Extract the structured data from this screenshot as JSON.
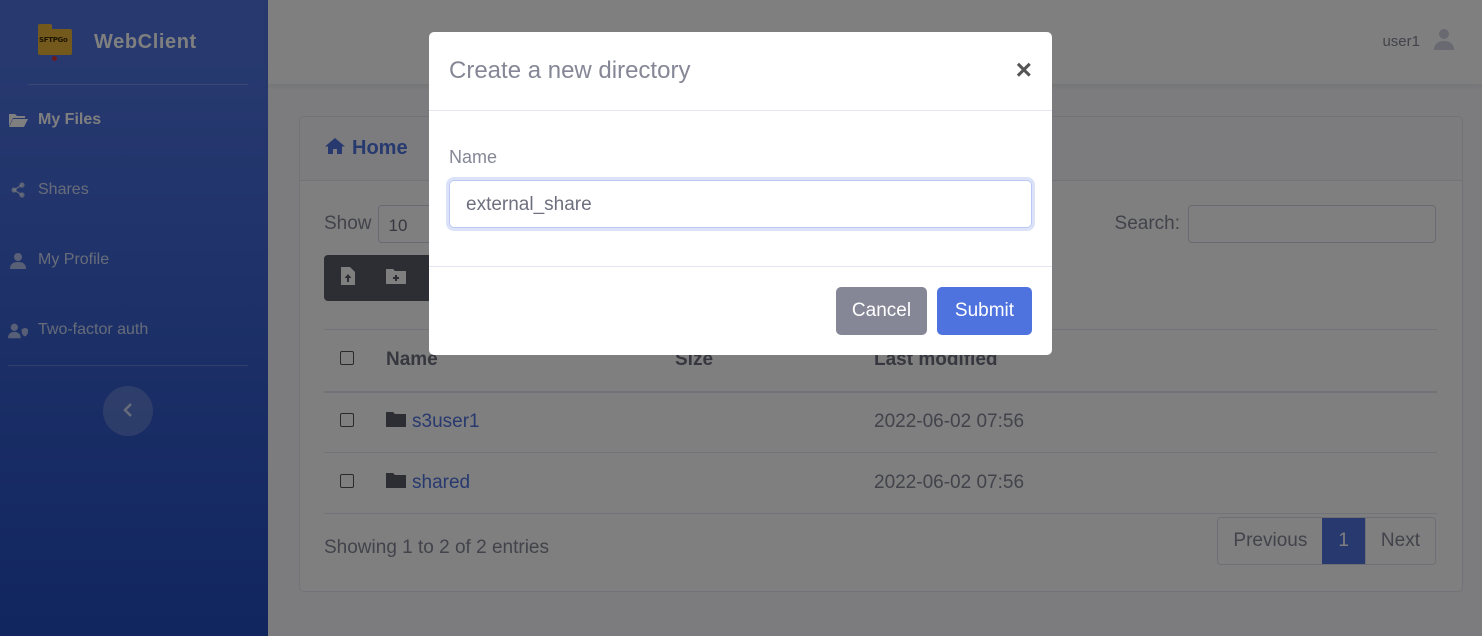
{
  "sidebar": {
    "brand": "WebClient",
    "logo_text": "SFTPGo",
    "items": [
      {
        "label": "My Files",
        "icon": "folder-open-icon"
      },
      {
        "label": "Shares",
        "icon": "share-icon"
      },
      {
        "label": "My Profile",
        "icon": "user-icon"
      },
      {
        "label": "Two-factor auth",
        "icon": "user-shield-icon"
      }
    ],
    "toggle_icon": "chevron-left-icon"
  },
  "topbar": {
    "username": "user1",
    "avatar_icon": "user-icon"
  },
  "card": {
    "title": "Home",
    "title_icon": "home-icon",
    "show_label": "Show",
    "page_length": "10",
    "search_label": "Search:",
    "search_value": ""
  },
  "table": {
    "columns": [
      "Name",
      "Size",
      "Last modified"
    ],
    "rows": [
      {
        "name": "s3user1",
        "size": "",
        "modified": "2022-06-02 07:56"
      },
      {
        "name": "shared",
        "size": "",
        "modified": "2022-06-02 07:56"
      }
    ]
  },
  "footer": {
    "info": "Showing 1 to 2 of 2 entries",
    "previous": "Previous",
    "current_page": "1",
    "next": "Next"
  },
  "modal": {
    "title": "Create a new directory",
    "close_glyph": "×",
    "name_label": "Name",
    "name_value": "external_share",
    "cancel": "Cancel",
    "submit": "Submit"
  },
  "colors": {
    "primary": "#4e73df",
    "secondary": "#858796",
    "sidebar_gradient_end": "#224abe"
  }
}
